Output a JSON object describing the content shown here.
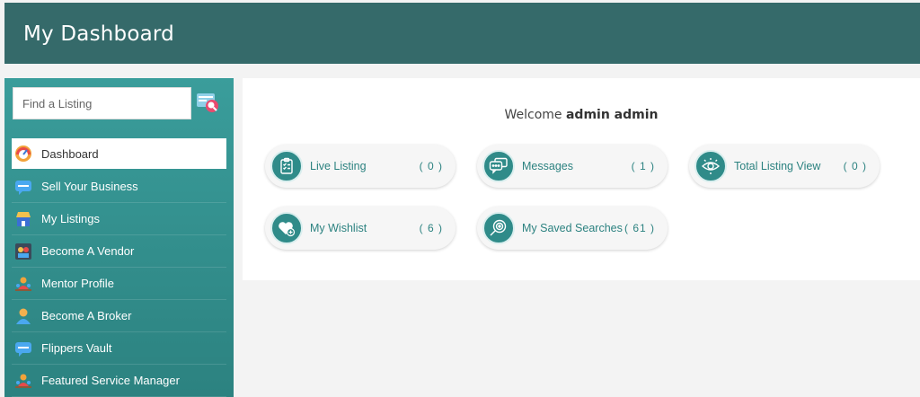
{
  "header": {
    "title": "My Dashboard"
  },
  "sidebar": {
    "search": {
      "placeholder": "Find a Listing",
      "icon": "search-listing-icon"
    },
    "items": [
      {
        "label": "Dashboard",
        "icon": "gauge-icon",
        "active": true
      },
      {
        "label": "Sell Your Business",
        "icon": "chat-bubble-icon"
      },
      {
        "label": "My Listings",
        "icon": "store-icon"
      },
      {
        "label": "Become A Vendor",
        "icon": "vendor-icon"
      },
      {
        "label": "Mentor Profile",
        "icon": "mentor-icon"
      },
      {
        "label": "Become A Broker",
        "icon": "person-icon"
      },
      {
        "label": "Flippers Vault",
        "icon": "chat-bubble-icon"
      },
      {
        "label": "Featured Service Manager",
        "icon": "mentor-icon"
      }
    ]
  },
  "main": {
    "welcome_prefix": "Welcome",
    "welcome_name": "admin admin",
    "cards": [
      {
        "label": "Live Listing",
        "count": "( 0 )",
        "icon": "clipboard-icon"
      },
      {
        "label": "Messages",
        "count": "( 1 )",
        "icon": "messages-icon"
      },
      {
        "label": "Total Listing View",
        "count": "( 0 )",
        "icon": "eye-icon"
      },
      {
        "label": "My Wishlist",
        "count": "( 6 )",
        "icon": "heart-plus-icon"
      },
      {
        "label": "My Saved Searches",
        "count": "( 61 )",
        "icon": "magnifier-icon"
      }
    ]
  },
  "colors": {
    "header": "#356a6a",
    "sidebar": "#3a9d9b",
    "accent": "#2f8b89"
  }
}
